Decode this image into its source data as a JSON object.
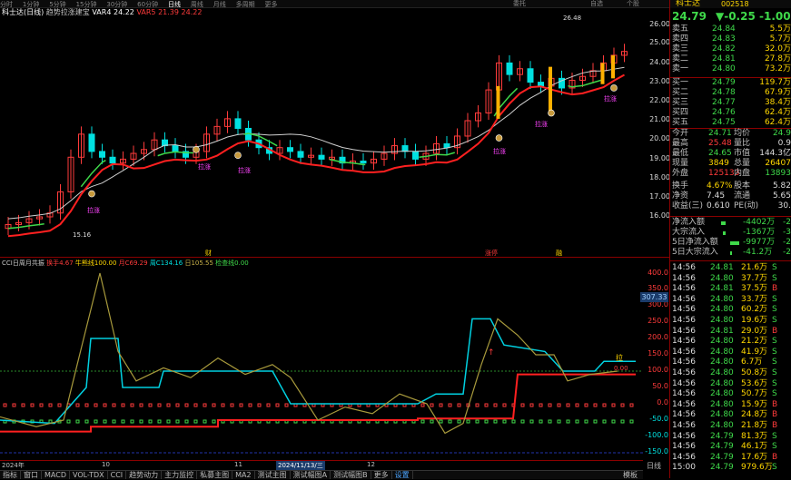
{
  "topbar": {
    "items": [
      "分时",
      "1分钟",
      "5分钟",
      "15分钟",
      "30分钟",
      "60分钟",
      "日线",
      "周线",
      "月线",
      "多周期",
      "更多"
    ],
    "right_items": [
      "委托",
      "自选",
      "个股"
    ]
  },
  "chart_info": {
    "title": "科士达(日线)",
    "indicator": "趋势拉涨建宝",
    "var4_label": "VAR4",
    "var4_value": "24.22",
    "var5_label": "VAR5",
    "var5_value": "21.39",
    "extra_value": "24.22"
  },
  "price_axis": [
    "26.00",
    "25.00",
    "24.00",
    "23.00",
    "22.00",
    "21.00",
    "20.00",
    "19.00",
    "18.00",
    "17.00",
    "16.00"
  ],
  "annotations": {
    "high": "26.48",
    "low": "15.16",
    "pull_labels": [
      "拉涨",
      "拉涨",
      "拉涨",
      "拉涨",
      "拉涨",
      "拉涨",
      "拉涨"
    ],
    "event_cai": "财",
    "event_zhangting": "涨停",
    "event_rong": "融"
  },
  "cci_info": {
    "title": "CCI日周月共振",
    "l1": "换手",
    "v1": "4.67",
    "l2": "牛熊线",
    "v2": "100.00",
    "l3": "月C",
    "v3": "69.29",
    "l4": "周C",
    "v4": "134.16",
    "l5": "日",
    "v5": "105.55",
    "l6": "检查线",
    "v6": "0.00"
  },
  "cci_axis": [
    "400.0",
    "350.0",
    "300.0",
    "250.0",
    "200.0",
    "150.0",
    "100.0",
    "50.0",
    "0.0",
    "-50.0",
    "-100.0",
    "-150.0"
  ],
  "cci_current": "307.33",
  "cci_marks": {
    "la": "拉",
    "dot": "0.00"
  },
  "date_axis": [
    "2024年",
    "10",
    "11",
    "2024/11/13/三",
    "12"
  ],
  "tabs": [
    "指标",
    "窗口",
    "MACD",
    "VOL-TDX",
    "CCI",
    "趋势动力",
    "主力监控",
    "私募主图",
    "MA2",
    "测试主图",
    "测试幅图A",
    "测试幅图B",
    "更多",
    "设置"
  ],
  "tabs_right": [
    "模板",
    "日线"
  ],
  "quote": {
    "name": "科士达",
    "code": "002518",
    "price": "24.79",
    "change": "▼-0.25",
    "pct": "-1.00%"
  },
  "asks": [
    {
      "label": "卖五",
      "p": "24.84",
      "v": "5.5万"
    },
    {
      "label": "卖四",
      "p": "24.83",
      "v": "5.7万"
    },
    {
      "label": "卖三",
      "p": "24.82",
      "v": "32.0万"
    },
    {
      "label": "卖二",
      "p": "24.81",
      "v": "27.8万"
    },
    {
      "label": "卖一",
      "p": "24.80",
      "v": "73.2万"
    }
  ],
  "bids": [
    {
      "label": "买一",
      "p": "24.79",
      "v": "119.7万"
    },
    {
      "label": "买二",
      "p": "24.78",
      "v": "67.9万"
    },
    {
      "label": "买三",
      "p": "24.77",
      "v": "38.4万"
    },
    {
      "label": "买四",
      "p": "24.76",
      "v": "62.4万"
    },
    {
      "label": "买五",
      "p": "24.75",
      "v": "62.4万"
    }
  ],
  "stats": [
    {
      "l1": "今开",
      "v1": "24.71",
      "l2": "均价",
      "v2": "24.9"
    },
    {
      "l1": "最高",
      "v1": "25.48",
      "l2": "量比",
      "v2": "0.9"
    },
    {
      "l1": "最低",
      "v1": "24.65",
      "l2": "市值",
      "v2": "144.3亿"
    },
    {
      "l1": "现量",
      "v1": "3849",
      "l2": "总量",
      "v2": "26407"
    },
    {
      "l1": "外盘",
      "v1": "125133",
      "l2": "内盘",
      "v2": "13893"
    }
  ],
  "stats2": [
    {
      "l1": "换手",
      "v1": "4.67%",
      "l2": "股本",
      "v2": "5.82"
    },
    {
      "l1": "净资",
      "v1": "7.45",
      "l2": "流通",
      "v2": "5.65"
    },
    {
      "l1": "收益(三)",
      "v1": "0.610",
      "l2": "PE(动)",
      "v2": "30."
    }
  ],
  "flows": [
    {
      "l": "净流入额",
      "v": "-4402万",
      "v2": "-2"
    },
    {
      "l": "大宗流入",
      "v": "-1367万",
      "v2": "-3"
    },
    {
      "l": "5日净流入额",
      "v": "-9977万",
      "v2": "-2"
    },
    {
      "l": "5日大宗流入",
      "v": "-41.2万",
      "v2": "-2"
    }
  ],
  "ticks": [
    {
      "t": "14:56",
      "p": "24.81",
      "v": "21.6万",
      "s": "S"
    },
    {
      "t": "14:56",
      "p": "24.80",
      "v": "37.7万",
      "s": "S"
    },
    {
      "t": "14:56",
      "p": "24.81",
      "v": "37.5万",
      "s": "B"
    },
    {
      "t": "14:56",
      "p": "24.80",
      "v": "33.7万",
      "s": "S"
    },
    {
      "t": "14:56",
      "p": "24.80",
      "v": "60.2万",
      "s": "S"
    },
    {
      "t": "14:56",
      "p": "24.80",
      "v": "19.6万",
      "s": "S"
    },
    {
      "t": "14:56",
      "p": "24.81",
      "v": "29.0万",
      "s": "B"
    },
    {
      "t": "14:56",
      "p": "24.80",
      "v": "21.2万",
      "s": "S"
    },
    {
      "t": "14:56",
      "p": "24.80",
      "v": "41.9万",
      "s": "S"
    },
    {
      "t": "14:56",
      "p": "24.80",
      "v": "6.7万",
      "s": "S"
    },
    {
      "t": "14:56",
      "p": "24.80",
      "v": "50.8万",
      "s": "S"
    },
    {
      "t": "14:56",
      "p": "24.80",
      "v": "53.6万",
      "s": "S"
    },
    {
      "t": "14:56",
      "p": "24.80",
      "v": "50.7万",
      "s": "S"
    },
    {
      "t": "14:56",
      "p": "24.80",
      "v": "15.9万",
      "s": "B"
    },
    {
      "t": "14:56",
      "p": "24.80",
      "v": "24.8万",
      "s": "B"
    },
    {
      "t": "14:56",
      "p": "24.80",
      "v": "21.8万",
      "s": "B"
    },
    {
      "t": "14:56",
      "p": "24.79",
      "v": "81.3万",
      "s": "S"
    },
    {
      "t": "14:56",
      "p": "24.79",
      "v": "46.1万",
      "s": "S"
    },
    {
      "t": "14:56",
      "p": "24.79",
      "v": "17.6万",
      "s": "B"
    },
    {
      "t": "15:00",
      "p": "24.79",
      "v": "979.6万",
      "s": "S"
    }
  ],
  "colors": {
    "up": "#ff3b3b",
    "down": "#00e0e0",
    "yellow": "#ffd700",
    "green": "#3fd94a",
    "magenta": "#ff44ff"
  }
}
